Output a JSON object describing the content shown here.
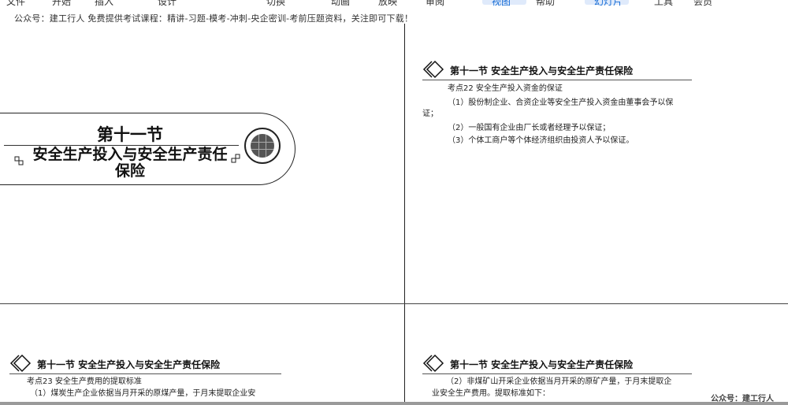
{
  "top_notice": "公众号：建工行人 免费提供考试课程：精讲-习题-模考-冲刺-央企密训-考前压题资料，关注即可下载！",
  "slide1": {
    "title": "第十一节",
    "subtitle_line1": "安全生产投入与安全生产责任",
    "subtitle_line2": "保险"
  },
  "slide2": {
    "header": "第十一节 安全生产投入与安全生产责任保险",
    "point": "考点22 安全生产投入资金的保证",
    "line1": "（1）股份制企业、合资企业等安全生产投入资金由董事会予以保",
    "line1b": "证；",
    "line2": "（2）一般国有企业由厂长或者经理予以保证；",
    "line3": "（3）个体工商户等个体经济组织由投资人予以保证。"
  },
  "slide3": {
    "header": "第十一节 安全生产投入与安全生产责任保险",
    "point": "考点23 安全生产费用的提取标准",
    "line1": "（1）煤炭生产企业依据当月开采的原煤产量，于月末提取企业安"
  },
  "slide4": {
    "header": "第十一节 安全生产投入与安全生产责任保险",
    "line1": "（2）非煤矿山开采企业依据当月开采的原矿产量，于月末提取企",
    "line2": "业安全生产费用。提取标准如下："
  },
  "watermark": "公众号：建工行人"
}
